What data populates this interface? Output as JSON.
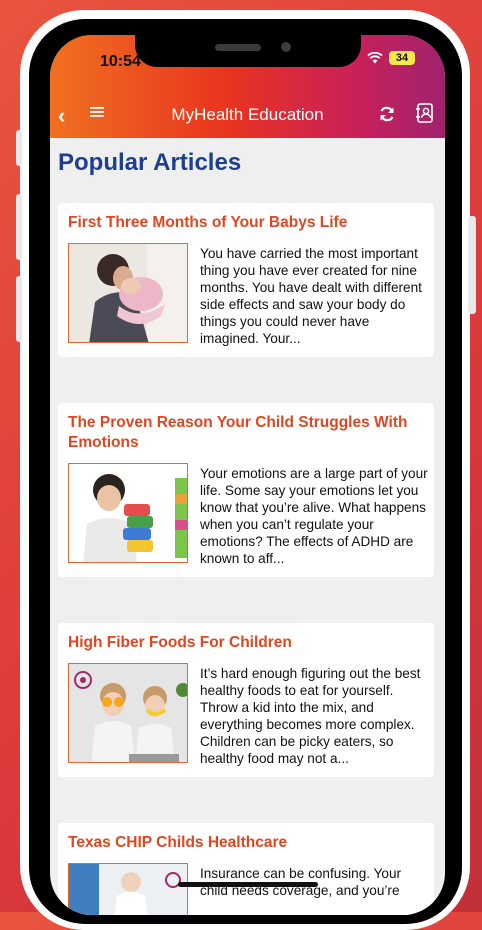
{
  "status_bar": {
    "time": "10:54",
    "battery": "34"
  },
  "nav": {
    "title": "MyHealth Education"
  },
  "page": {
    "title": "Popular Articles"
  },
  "articles": [
    {
      "title": "First Three Months of Your Babys Life",
      "excerpt": "You have carried the most important thing you have ever created for nine months. You have dealt with different side effects and saw your body do things you could never have imagined. Your..."
    },
    {
      "title": "The Proven Reason Your Child Struggles With Emotions",
      "excerpt": "Your emotions are a large part of your life. Some say your emotions let you know that you’re alive. What happens when you can’t regulate your emotions? The effects of ADHD are known to aff..."
    },
    {
      "title": "High Fiber Foods For Children",
      "excerpt": "It’s hard enough figuring out the best healthy foods to eat for yourself. Throw a kid into the mix, and everything becomes more complex. Children can be picky eaters, so healthy food may not a..."
    },
    {
      "title": "Texas CHIP Childs Healthcare",
      "excerpt": "Insurance can be confusing. Your child needs coverage, and you’re"
    }
  ],
  "colors": {
    "accent": "#e0461f",
    "title_blue": "#1d3f8f",
    "background": "#efefef"
  }
}
